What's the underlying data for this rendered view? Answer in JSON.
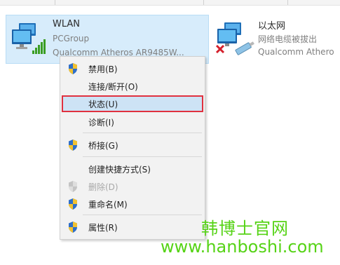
{
  "adapters": {
    "wlan": {
      "name": "WLAN",
      "network": "PCGroup",
      "device": "Qualcomm Atheros AR9485W..."
    },
    "ethernet": {
      "name": "以太网",
      "status": "网络电缆被拔出",
      "device": "Qualcomm Athero"
    }
  },
  "context_menu": {
    "items": [
      {
        "label": "禁用(B)",
        "icon": "shield-icon"
      },
      {
        "label": "连接/断开(O)",
        "icon": ""
      },
      {
        "label": "状态(U)",
        "icon": "",
        "selected": true
      },
      {
        "label": "诊断(I)",
        "icon": ""
      },
      {
        "label": "桥接(G)",
        "icon": "shield-icon"
      },
      {
        "label": "创建快捷方式(S)",
        "icon": ""
      },
      {
        "label": "删除(D)",
        "icon": "shield-icon",
        "disabled": true
      },
      {
        "label": "重命名(M)",
        "icon": "shield-icon"
      },
      {
        "label": "属性(R)",
        "icon": "shield-icon"
      }
    ]
  },
  "watermark": {
    "line1": "韩博士官网",
    "line2": "www.hanboshi.com"
  },
  "colors": {
    "selection_bg": "#d7ecfb",
    "highlight_border": "#e0313f",
    "watermark": "#56d316"
  }
}
